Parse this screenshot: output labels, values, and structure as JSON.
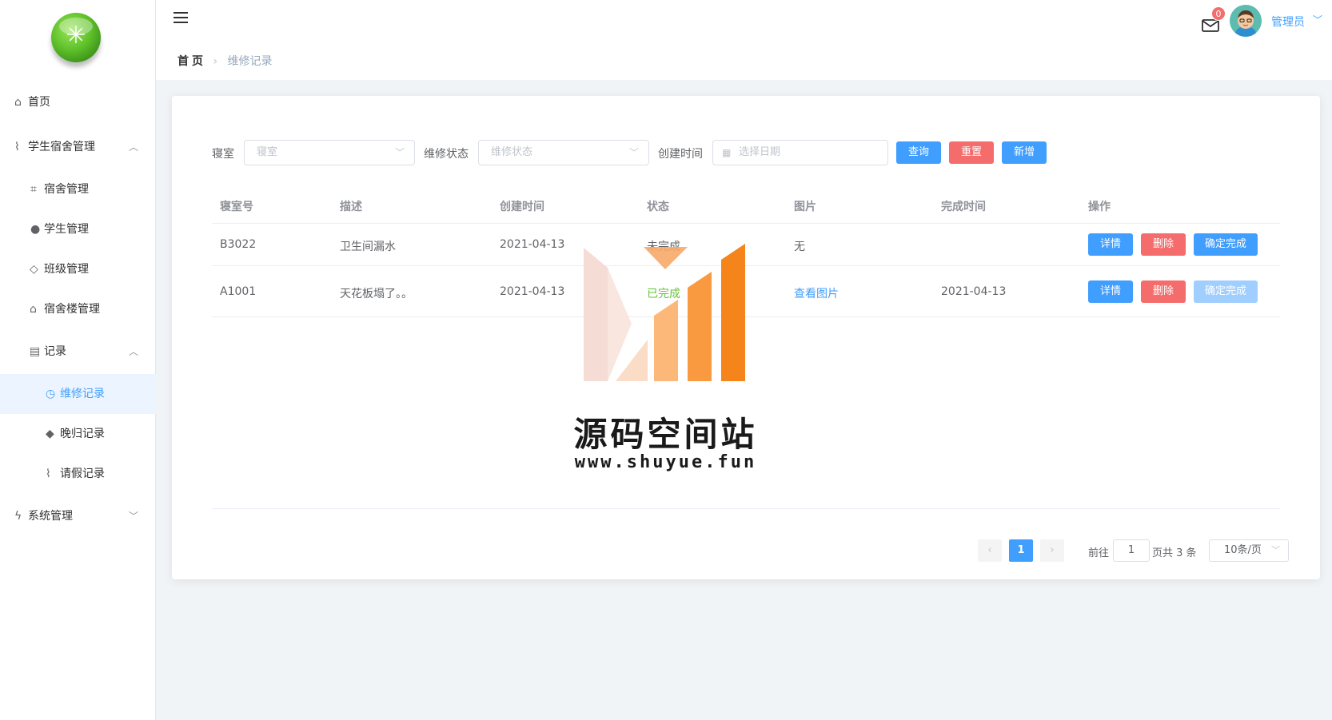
{
  "sidebar": {
    "items": [
      {
        "label": "首页",
        "icon": "home-icon"
      },
      {
        "label": "学生宿舍管理",
        "icon": "paperclip-icon"
      },
      {
        "label": "宿舍管理",
        "icon": "crop-icon"
      },
      {
        "label": "学生管理",
        "icon": "user-icon"
      },
      {
        "label": "班级管理",
        "icon": "graduation-cap-icon"
      },
      {
        "label": "宿舍楼管理",
        "icon": "house-icon"
      },
      {
        "label": "记录",
        "icon": "document-icon"
      },
      {
        "label": "维修记录",
        "icon": "alarm-clock-icon"
      },
      {
        "label": "晚归记录",
        "icon": "tag-icon"
      },
      {
        "label": "请假记录",
        "icon": "paperclip-icon"
      },
      {
        "label": "系统管理",
        "icon": "lightning-icon"
      }
    ]
  },
  "header": {
    "breadcrumb_home": "首页",
    "breadcrumb_current": "维修记录",
    "mail_badge": "0",
    "user_name": "管理员"
  },
  "filters": {
    "room_label": "寝室",
    "room_placeholder": "寝室",
    "status_label": "维修状态",
    "status_placeholder": "维修状态",
    "created_label": "创建时间",
    "date_placeholder": "选择日期",
    "query_button": "查询",
    "reset_button": "重置",
    "add_button": "新增"
  },
  "table": {
    "columns": [
      "寝室号",
      "描述",
      "创建时间",
      "状态",
      "图片",
      "完成时间",
      "操作"
    ],
    "rows": [
      {
        "room": "B3022",
        "desc": "卫生间漏水",
        "created": "2021-04-13",
        "status": "未完成",
        "image": "无",
        "finished": "",
        "detail": "详情",
        "delete": "删除",
        "confirm": "确定完成"
      },
      {
        "room": "A1001",
        "desc": "天花板塌了。。",
        "created": "2021-04-13",
        "status": "已完成",
        "image": "查看图片",
        "finished": "2021-04-13",
        "detail": "详情",
        "delete": "删除",
        "confirm": "确定完成"
      }
    ]
  },
  "pagination": {
    "current_page": "1",
    "goto_label": "前往",
    "goto_value": "1",
    "total_label": "页共 3 条",
    "page_size": "10条/页"
  },
  "watermark": {
    "title": "源码空间站",
    "url": "www.shuyue.fun"
  },
  "colors": {
    "primary": "#409eff",
    "danger": "#f56c6c",
    "success": "#67c23a",
    "disabled": "#a0cfff",
    "logo": "#5fc12a"
  }
}
